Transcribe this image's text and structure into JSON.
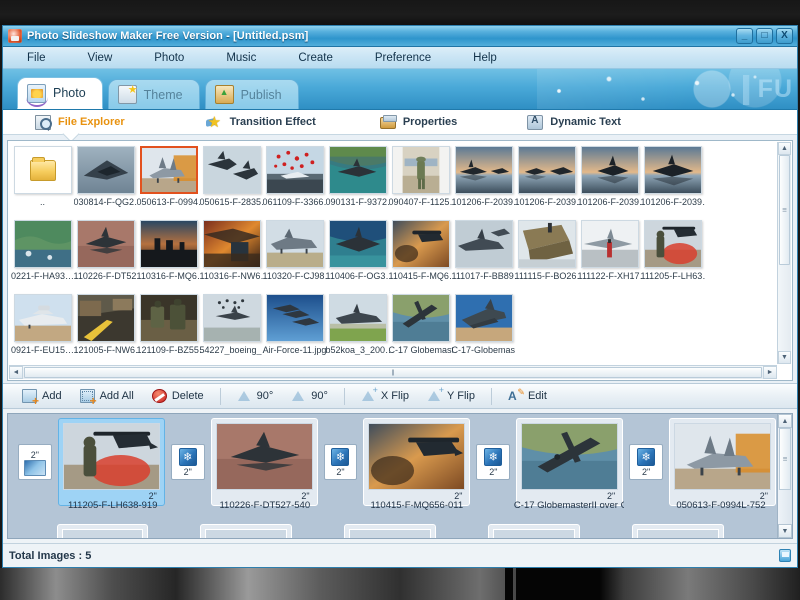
{
  "window": {
    "title": "Photo Slideshow Maker Free Version - [Untitled.psm]",
    "app_icon": "app-icon",
    "minimize": "_",
    "maximize": "□",
    "close": "X"
  },
  "menubar": {
    "items": [
      "File",
      "View",
      "Photo",
      "Music",
      "Create",
      "Preference",
      "Help"
    ]
  },
  "banner": {
    "word": "FU"
  },
  "tabs": [
    {
      "label": "Photo",
      "icon": "photo-icon",
      "active": true
    },
    {
      "label": "Theme",
      "icon": "theme-icon",
      "active": false
    },
    {
      "label": "Publish",
      "icon": "publish-icon",
      "active": false
    }
  ],
  "subbar": [
    {
      "label": "File Explorer",
      "icon": "magnifier-icon",
      "selected": true
    },
    {
      "label": "Transition Effect",
      "icon": "star-icon",
      "selected": false
    },
    {
      "label": "Properties",
      "icon": "drawer-icon",
      "selected": false
    },
    {
      "label": "Dynamic Text",
      "icon": "text-tool-icon",
      "selected": false
    }
  ],
  "browser": {
    "rows": [
      [
        {
          "name": "..",
          "kind": "folder"
        },
        {
          "name": "030814-F-QG2…",
          "kind": "image",
          "art": "stealth"
        },
        {
          "name": "050613-F-0994…",
          "kind": "image",
          "art": "jet-ground",
          "selected": true
        },
        {
          "name": "050615-F-2835…",
          "kind": "image",
          "art": "two-jets"
        },
        {
          "name": "061109-F-3366…",
          "kind": "image",
          "art": "confetti"
        },
        {
          "name": "090131-F-9372…",
          "kind": "image",
          "art": "osprey-sea"
        },
        {
          "name": "090407-F-1125…",
          "kind": "image",
          "art": "soldier"
        },
        {
          "name": "101206-F-2039…",
          "kind": "image",
          "art": "sunset-jets"
        },
        {
          "name": "101206-F-2039…",
          "kind": "image",
          "art": "sunset-jets"
        },
        {
          "name": "101206-F-2039…",
          "kind": "image",
          "art": "sunset-jets"
        },
        {
          "name": "101206-F-2039…",
          "kind": "image",
          "art": "sunset-jets"
        }
      ],
      [
        {
          "name": "0221-F-HA93…",
          "kind": "image",
          "art": "coast"
        },
        {
          "name": "110226-F-DT52…",
          "kind": "image",
          "art": "desert-bomber"
        },
        {
          "name": "110316-F-MQ6…",
          "kind": "image",
          "art": "dusk-troops"
        },
        {
          "name": "110316-F-NW6…",
          "kind": "image",
          "art": "orange-cockpit"
        },
        {
          "name": "110320-F-CJ98…",
          "kind": "image",
          "art": "grey-jet"
        },
        {
          "name": "110406-F-OG3…",
          "kind": "image",
          "art": "ocean-jet"
        },
        {
          "name": "110415-F-MQ6…",
          "kind": "image",
          "art": "dust-heli"
        },
        {
          "name": "111017-F-BB89…",
          "kind": "image",
          "art": "two-jets"
        },
        {
          "name": "111115-F-BO26…",
          "kind": "image",
          "art": "cargo"
        },
        {
          "name": "111122-F-XH17…",
          "kind": "image",
          "art": "ramp-crew"
        },
        {
          "name": "111205-F-LH63…",
          "kind": "image",
          "art": "red-smoke"
        }
      ],
      [
        {
          "name": "0921-F-EU15…",
          "kind": "image",
          "art": "shuttle"
        },
        {
          "name": "121005-F-NW6…",
          "kind": "image",
          "art": "yellow-road"
        },
        {
          "name": "121109-F-BZ55…",
          "kind": "image",
          "art": "gear-crew"
        },
        {
          "name": "54227_boeing_…",
          "kind": "image",
          "art": "formation-sky"
        },
        {
          "name": "Air-Force-11.jpg",
          "kind": "image",
          "art": "blue-formation"
        },
        {
          "name": "b52koa_3_200…",
          "kind": "image",
          "art": "bomber-field"
        },
        {
          "name": "C-17 Globemast…",
          "kind": "image",
          "art": "globemaster-coast"
        },
        {
          "name": "C-17-Globemas…",
          "kind": "image",
          "art": "globemaster-takeoff"
        }
      ]
    ],
    "hscroll_left": "◄",
    "hscroll_right": "►",
    "vscroll_up": "▲",
    "vscroll_down": "▼"
  },
  "actionbar": {
    "buttons": [
      {
        "label": "Add",
        "icon": "add-icon"
      },
      {
        "label": "Add All",
        "icon": "add-all-icon"
      },
      {
        "label": "Delete",
        "icon": "delete-icon"
      },
      {
        "label": "90°",
        "icon": "rotate-left-icon"
      },
      {
        "label": "90°",
        "icon": "rotate-right-icon"
      },
      {
        "label": "X Flip",
        "icon": "flip-x-icon"
      },
      {
        "label": "Y Flip",
        "icon": "flip-y-icon"
      },
      {
        "label": "Edit",
        "icon": "edit-icon"
      }
    ]
  },
  "storyboard": {
    "first_transition_duration": "2\"",
    "slides": [
      {
        "name": "111205-F-LH638-919",
        "duration": "2\"",
        "art": "red-smoke",
        "selected": true,
        "transition_duration": "2\""
      },
      {
        "name": "110226-F-DT527-540",
        "duration": "2\"",
        "art": "desert-bomber",
        "selected": false,
        "transition_duration": "2\""
      },
      {
        "name": "110415-F-MQ656-011",
        "duration": "2\"",
        "art": "dust-heli",
        "selected": false,
        "transition_duration": "2\""
      },
      {
        "name": "C-17 GlobemasterII over C…",
        "duration": "2\"",
        "art": "globemaster-coast",
        "selected": false,
        "transition_duration": "2\""
      },
      {
        "name": "050613-F-0994L-752",
        "duration": "2\"",
        "art": "jet-ground",
        "selected": false,
        "transition_duration": null
      }
    ],
    "transition_icon": "snowflake-cube-icon",
    "vscroll_up": "▲",
    "vscroll_down": "▼"
  },
  "statusbar": {
    "text": "Total Images : 5",
    "icon": "screen-icon"
  },
  "colors": {
    "title_gradient_start": "#8fd2ee",
    "title_gradient_end": "#2e95cc",
    "accent_orange": "#e8920f",
    "selection_orange": "#e2511e",
    "selection_blue": "#9ed3f5",
    "storyboard_bg": "#b4c5d6"
  }
}
